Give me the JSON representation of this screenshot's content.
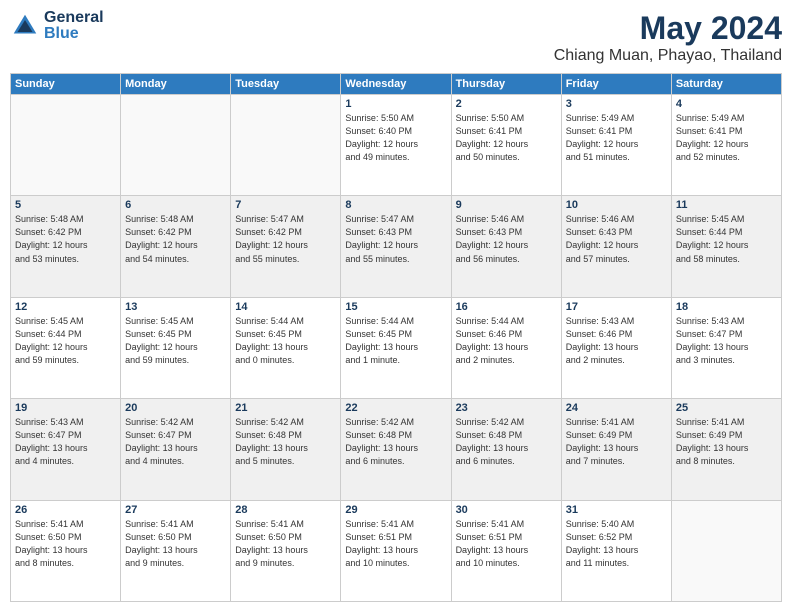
{
  "logo": {
    "general": "General",
    "blue": "Blue"
  },
  "title": "May 2024",
  "location": "Chiang Muan, Phayao, Thailand",
  "headers": [
    "Sunday",
    "Monday",
    "Tuesday",
    "Wednesday",
    "Thursday",
    "Friday",
    "Saturday"
  ],
  "weeks": [
    {
      "shade": false,
      "days": [
        {
          "number": "",
          "info": ""
        },
        {
          "number": "",
          "info": ""
        },
        {
          "number": "",
          "info": ""
        },
        {
          "number": "1",
          "info": "Sunrise: 5:50 AM\nSunset: 6:40 PM\nDaylight: 12 hours\nand 49 minutes."
        },
        {
          "number": "2",
          "info": "Sunrise: 5:50 AM\nSunset: 6:41 PM\nDaylight: 12 hours\nand 50 minutes."
        },
        {
          "number": "3",
          "info": "Sunrise: 5:49 AM\nSunset: 6:41 PM\nDaylight: 12 hours\nand 51 minutes."
        },
        {
          "number": "4",
          "info": "Sunrise: 5:49 AM\nSunset: 6:41 PM\nDaylight: 12 hours\nand 52 minutes."
        }
      ]
    },
    {
      "shade": true,
      "days": [
        {
          "number": "5",
          "info": "Sunrise: 5:48 AM\nSunset: 6:42 PM\nDaylight: 12 hours\nand 53 minutes."
        },
        {
          "number": "6",
          "info": "Sunrise: 5:48 AM\nSunset: 6:42 PM\nDaylight: 12 hours\nand 54 minutes."
        },
        {
          "number": "7",
          "info": "Sunrise: 5:47 AM\nSunset: 6:42 PM\nDaylight: 12 hours\nand 55 minutes."
        },
        {
          "number": "8",
          "info": "Sunrise: 5:47 AM\nSunset: 6:43 PM\nDaylight: 12 hours\nand 55 minutes."
        },
        {
          "number": "9",
          "info": "Sunrise: 5:46 AM\nSunset: 6:43 PM\nDaylight: 12 hours\nand 56 minutes."
        },
        {
          "number": "10",
          "info": "Sunrise: 5:46 AM\nSunset: 6:43 PM\nDaylight: 12 hours\nand 57 minutes."
        },
        {
          "number": "11",
          "info": "Sunrise: 5:45 AM\nSunset: 6:44 PM\nDaylight: 12 hours\nand 58 minutes."
        }
      ]
    },
    {
      "shade": false,
      "days": [
        {
          "number": "12",
          "info": "Sunrise: 5:45 AM\nSunset: 6:44 PM\nDaylight: 12 hours\nand 59 minutes."
        },
        {
          "number": "13",
          "info": "Sunrise: 5:45 AM\nSunset: 6:45 PM\nDaylight: 12 hours\nand 59 minutes."
        },
        {
          "number": "14",
          "info": "Sunrise: 5:44 AM\nSunset: 6:45 PM\nDaylight: 13 hours\nand 0 minutes."
        },
        {
          "number": "15",
          "info": "Sunrise: 5:44 AM\nSunset: 6:45 PM\nDaylight: 13 hours\nand 1 minute."
        },
        {
          "number": "16",
          "info": "Sunrise: 5:44 AM\nSunset: 6:46 PM\nDaylight: 13 hours\nand 2 minutes."
        },
        {
          "number": "17",
          "info": "Sunrise: 5:43 AM\nSunset: 6:46 PM\nDaylight: 13 hours\nand 2 minutes."
        },
        {
          "number": "18",
          "info": "Sunrise: 5:43 AM\nSunset: 6:47 PM\nDaylight: 13 hours\nand 3 minutes."
        }
      ]
    },
    {
      "shade": true,
      "days": [
        {
          "number": "19",
          "info": "Sunrise: 5:43 AM\nSunset: 6:47 PM\nDaylight: 13 hours\nand 4 minutes."
        },
        {
          "number": "20",
          "info": "Sunrise: 5:42 AM\nSunset: 6:47 PM\nDaylight: 13 hours\nand 4 minutes."
        },
        {
          "number": "21",
          "info": "Sunrise: 5:42 AM\nSunset: 6:48 PM\nDaylight: 13 hours\nand 5 minutes."
        },
        {
          "number": "22",
          "info": "Sunrise: 5:42 AM\nSunset: 6:48 PM\nDaylight: 13 hours\nand 6 minutes."
        },
        {
          "number": "23",
          "info": "Sunrise: 5:42 AM\nSunset: 6:48 PM\nDaylight: 13 hours\nand 6 minutes."
        },
        {
          "number": "24",
          "info": "Sunrise: 5:41 AM\nSunset: 6:49 PM\nDaylight: 13 hours\nand 7 minutes."
        },
        {
          "number": "25",
          "info": "Sunrise: 5:41 AM\nSunset: 6:49 PM\nDaylight: 13 hours\nand 8 minutes."
        }
      ]
    },
    {
      "shade": false,
      "days": [
        {
          "number": "26",
          "info": "Sunrise: 5:41 AM\nSunset: 6:50 PM\nDaylight: 13 hours\nand 8 minutes."
        },
        {
          "number": "27",
          "info": "Sunrise: 5:41 AM\nSunset: 6:50 PM\nDaylight: 13 hours\nand 9 minutes."
        },
        {
          "number": "28",
          "info": "Sunrise: 5:41 AM\nSunset: 6:50 PM\nDaylight: 13 hours\nand 9 minutes."
        },
        {
          "number": "29",
          "info": "Sunrise: 5:41 AM\nSunset: 6:51 PM\nDaylight: 13 hours\nand 10 minutes."
        },
        {
          "number": "30",
          "info": "Sunrise: 5:41 AM\nSunset: 6:51 PM\nDaylight: 13 hours\nand 10 minutes."
        },
        {
          "number": "31",
          "info": "Sunrise: 5:40 AM\nSunset: 6:52 PM\nDaylight: 13 hours\nand 11 minutes."
        },
        {
          "number": "",
          "info": ""
        }
      ]
    }
  ]
}
